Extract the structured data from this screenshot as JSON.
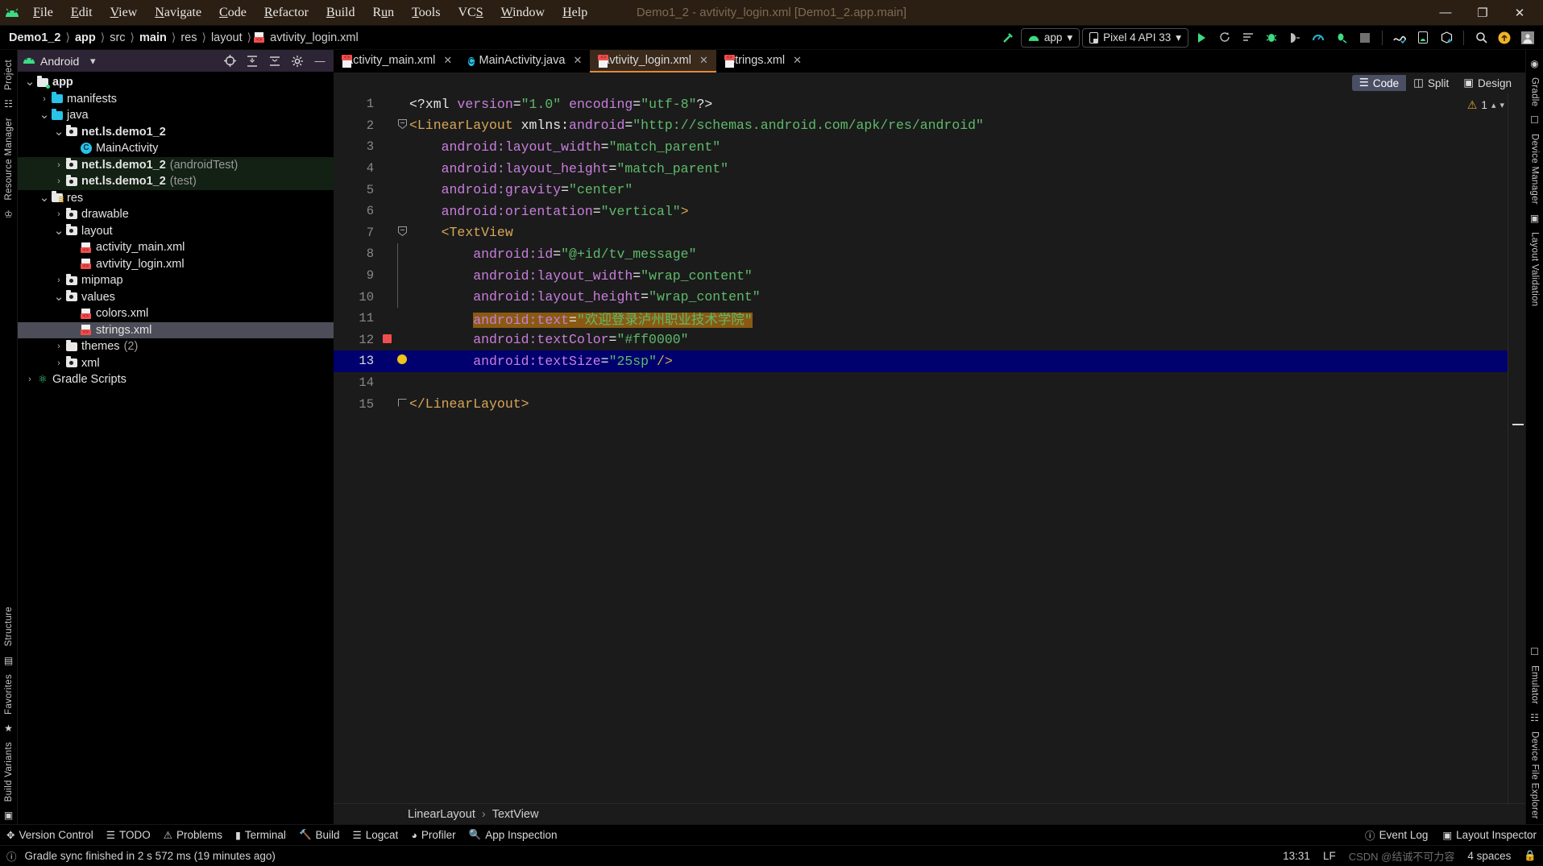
{
  "window": {
    "title": "Demo1_2 - avtivity_login.xml [Demo1_2.app.main]",
    "minimize": "—",
    "maximize": "❐",
    "close": "✕"
  },
  "menu": [
    "File",
    "Edit",
    "View",
    "Navigate",
    "Code",
    "Refactor",
    "Build",
    "Run",
    "Tools",
    "VCS",
    "Window",
    "Help"
  ],
  "breadcrumb": [
    {
      "label": "Demo1_2",
      "bold": true
    },
    {
      "label": "app",
      "bold": true
    },
    {
      "label": "src",
      "bold": false
    },
    {
      "label": "main",
      "bold": true
    },
    {
      "label": "res",
      "bold": false
    },
    {
      "label": "layout",
      "bold": false
    },
    {
      "label": "avtivity_login.xml",
      "bold": false
    }
  ],
  "toolbar": {
    "run_config": "app",
    "device": "Pixel 4 API 33",
    "icons": [
      "hammer-icon",
      "run-icon",
      "rerun-icon",
      "apply-changes-icon",
      "debug-icon",
      "attach-debugger-icon",
      "profiler-icon",
      "run-coverage-icon",
      "stop-icon",
      "sdk-manager-icon",
      "device-manager-icon",
      "avd-manager-icon",
      "search-icon",
      "update-icon",
      "account-icon",
      "settings-icon"
    ]
  },
  "project_panel": {
    "title": "Android",
    "header_icons": [
      "select-opened-file-icon",
      "collapse-all-icon",
      "expand-all-icon",
      "settings-gear-icon",
      "hide-icon"
    ],
    "tree": [
      {
        "label": "app",
        "sub": "",
        "depth": 0,
        "arrow": "down",
        "icon": "module-folder",
        "bold": true,
        "state": "normal"
      },
      {
        "label": "manifests",
        "sub": "",
        "depth": 1,
        "arrow": "right",
        "icon": "folder-blue",
        "bold": false,
        "state": "normal"
      },
      {
        "label": "java",
        "sub": "",
        "depth": 1,
        "arrow": "down",
        "icon": "folder-blue",
        "bold": false,
        "state": "normal"
      },
      {
        "label": "net.ls.demo1_2",
        "sub": "",
        "depth": 2,
        "arrow": "down",
        "icon": "package",
        "bold": true,
        "state": "normal"
      },
      {
        "label": "MainActivity",
        "sub": "",
        "depth": 3,
        "arrow": "none",
        "icon": "java-class",
        "bold": false,
        "state": "normal"
      },
      {
        "label": "net.ls.demo1_2",
        "sub": "(androidTest)",
        "depth": 2,
        "arrow": "right",
        "icon": "package",
        "bold": true,
        "state": "test"
      },
      {
        "label": "net.ls.demo1_2",
        "sub": "(test)",
        "depth": 2,
        "arrow": "right",
        "icon": "package",
        "bold": true,
        "state": "test"
      },
      {
        "label": "res",
        "sub": "",
        "depth": 1,
        "arrow": "down",
        "icon": "res-folder",
        "bold": false,
        "state": "normal"
      },
      {
        "label": "drawable",
        "sub": "",
        "depth": 2,
        "arrow": "right",
        "icon": "package",
        "bold": false,
        "state": "normal"
      },
      {
        "label": "layout",
        "sub": "",
        "depth": 2,
        "arrow": "down",
        "icon": "package",
        "bold": false,
        "state": "normal"
      },
      {
        "label": "activity_main.xml",
        "sub": "",
        "depth": 3,
        "arrow": "none",
        "icon": "xml-file",
        "bold": false,
        "state": "normal"
      },
      {
        "label": "avtivity_login.xml",
        "sub": "",
        "depth": 3,
        "arrow": "none",
        "icon": "xml-file",
        "bold": false,
        "state": "normal"
      },
      {
        "label": "mipmap",
        "sub": "",
        "depth": 2,
        "arrow": "right",
        "icon": "package",
        "bold": false,
        "state": "normal"
      },
      {
        "label": "values",
        "sub": "",
        "depth": 2,
        "arrow": "down",
        "icon": "package",
        "bold": false,
        "state": "normal"
      },
      {
        "label": "colors.xml",
        "sub": "",
        "depth": 3,
        "arrow": "none",
        "icon": "xml-file",
        "bold": false,
        "state": "normal"
      },
      {
        "label": "strings.xml",
        "sub": "",
        "depth": 3,
        "arrow": "none",
        "icon": "xml-file",
        "bold": false,
        "state": "selected"
      },
      {
        "label": "themes",
        "sub": "(2)",
        "depth": 2,
        "arrow": "right",
        "icon": "folder-white",
        "bold": false,
        "state": "normal"
      },
      {
        "label": "xml",
        "sub": "",
        "depth": 2,
        "arrow": "right",
        "icon": "package",
        "bold": false,
        "state": "normal"
      },
      {
        "label": "Gradle Scripts",
        "sub": "",
        "depth": 0,
        "arrow": "right",
        "icon": "gradle",
        "bold": false,
        "state": "normal"
      }
    ]
  },
  "left_rail": [
    "Project",
    "Resource Manager",
    "Structure",
    "Favorites",
    "Build Variants"
  ],
  "right_rail": [
    "Gradle",
    "Device Manager",
    "Layout Validation",
    "Emulator",
    "Device File Explorer"
  ],
  "editor": {
    "tabs": [
      {
        "label": "activity_main.xml",
        "icon": "xml-file-icon",
        "active": false,
        "close": "✕"
      },
      {
        "label": "MainActivity.java",
        "icon": "java-class-icon",
        "active": false,
        "close": "✕"
      },
      {
        "label": "avtivity_login.xml",
        "icon": "xml-file-icon",
        "active": true,
        "close": "✕"
      },
      {
        "label": "strings.xml",
        "icon": "xml-file-icon",
        "active": false,
        "close": "✕"
      }
    ],
    "view_modes": [
      {
        "label": "Code",
        "active": true,
        "icon": "code-view-icon"
      },
      {
        "label": "Split",
        "active": false,
        "icon": "split-view-icon"
      },
      {
        "label": "Design",
        "active": false,
        "icon": "design-view-icon"
      }
    ],
    "inspection": {
      "warning_count": "1",
      "warning_icon": "warning-triangle-icon"
    },
    "lines": [
      {
        "n": "1",
        "fold": "",
        "mark": "",
        "highlight": "none",
        "tokens": [
          {
            "t": "pun",
            "s": "<?xml "
          },
          {
            "t": "attr",
            "s": "version"
          },
          {
            "t": "pun",
            "s": "="
          },
          {
            "t": "val",
            "s": "\"1.0\""
          },
          {
            "t": "pun",
            "s": " "
          },
          {
            "t": "attr",
            "s": "encoding"
          },
          {
            "t": "pun",
            "s": "="
          },
          {
            "t": "val",
            "s": "\"utf-8\""
          },
          {
            "t": "pun",
            "s": "?>"
          }
        ]
      },
      {
        "n": "2",
        "fold": "minus",
        "mark": "",
        "highlight": "none",
        "tokens": [
          {
            "t": "tag",
            "s": "<LinearLayout "
          },
          {
            "t": "pun",
            "s": "xmlns:"
          },
          {
            "t": "attr",
            "s": "android"
          },
          {
            "t": "pun",
            "s": "="
          },
          {
            "t": "val",
            "s": "\"http://schemas.android.com/apk/res/android\""
          }
        ]
      },
      {
        "n": "3",
        "fold": "",
        "mark": "",
        "highlight": "none",
        "tokens": [
          {
            "t": "pun",
            "s": "    "
          },
          {
            "t": "attr",
            "s": "android:layout_width"
          },
          {
            "t": "pun",
            "s": "="
          },
          {
            "t": "val",
            "s": "\"match_parent\""
          }
        ]
      },
      {
        "n": "4",
        "fold": "",
        "mark": "",
        "highlight": "none",
        "tokens": [
          {
            "t": "pun",
            "s": "    "
          },
          {
            "t": "attr",
            "s": "android:layout_height"
          },
          {
            "t": "pun",
            "s": "="
          },
          {
            "t": "val",
            "s": "\"match_parent\""
          }
        ]
      },
      {
        "n": "5",
        "fold": "",
        "mark": "",
        "highlight": "none",
        "tokens": [
          {
            "t": "pun",
            "s": "    "
          },
          {
            "t": "attr",
            "s": "android:gravity"
          },
          {
            "t": "pun",
            "s": "="
          },
          {
            "t": "val",
            "s": "\"center\""
          }
        ]
      },
      {
        "n": "6",
        "fold": "",
        "mark": "",
        "highlight": "none",
        "tokens": [
          {
            "t": "pun",
            "s": "    "
          },
          {
            "t": "attr",
            "s": "android:orientation"
          },
          {
            "t": "pun",
            "s": "="
          },
          {
            "t": "val",
            "s": "\"vertical\""
          },
          {
            "t": "tag",
            "s": ">"
          }
        ]
      },
      {
        "n": "7",
        "fold": "minus",
        "mark": "",
        "highlight": "none",
        "tokens": [
          {
            "t": "pun",
            "s": "    "
          },
          {
            "t": "tag",
            "s": "<TextView"
          }
        ]
      },
      {
        "n": "8",
        "fold": "",
        "mark": "",
        "highlight": "none",
        "tokens": [
          {
            "t": "pun",
            "s": "        "
          },
          {
            "t": "attr",
            "s": "android:id"
          },
          {
            "t": "pun",
            "s": "="
          },
          {
            "t": "val",
            "s": "\"@+id/tv_message\""
          }
        ]
      },
      {
        "n": "9",
        "fold": "",
        "mark": "",
        "highlight": "none",
        "tokens": [
          {
            "t": "pun",
            "s": "        "
          },
          {
            "t": "attr",
            "s": "android:layout_width"
          },
          {
            "t": "pun",
            "s": "="
          },
          {
            "t": "val",
            "s": "\"wrap_content\""
          }
        ]
      },
      {
        "n": "10",
        "fold": "",
        "mark": "",
        "highlight": "none",
        "tokens": [
          {
            "t": "pun",
            "s": "        "
          },
          {
            "t": "attr",
            "s": "android:layout_height"
          },
          {
            "t": "pun",
            "s": "="
          },
          {
            "t": "val",
            "s": "\"wrap_content\""
          }
        ]
      },
      {
        "n": "11",
        "fold": "",
        "mark": "",
        "highlight": "orange",
        "tokens": [
          {
            "t": "pun",
            "s": "        "
          },
          {
            "t": "attr-hl",
            "s": "android:text"
          },
          {
            "t": "pun-hl",
            "s": "="
          },
          {
            "t": "val-hl",
            "s": "\"欢迎登录泸州职业技术学院\""
          }
        ]
      },
      {
        "n": "12",
        "fold": "",
        "mark": "breakpoint",
        "highlight": "none",
        "tokens": [
          {
            "t": "pun",
            "s": "        "
          },
          {
            "t": "attr",
            "s": "android:textColor"
          },
          {
            "t": "pun",
            "s": "="
          },
          {
            "t": "val",
            "s": "\"#ff0000\""
          }
        ]
      },
      {
        "n": "13",
        "fold": "bulb",
        "mark": "",
        "highlight": "cursor",
        "tokens": [
          {
            "t": "pun",
            "s": "        "
          },
          {
            "t": "attr",
            "s": "android:textSize"
          },
          {
            "t": "pun",
            "s": "="
          },
          {
            "t": "val",
            "s": "\"25sp\""
          },
          {
            "t": "tag",
            "s": "/>"
          }
        ]
      },
      {
        "n": "14",
        "fold": "",
        "mark": "",
        "highlight": "none",
        "tokens": []
      },
      {
        "n": "15",
        "fold": "end",
        "mark": "",
        "highlight": "none",
        "tokens": [
          {
            "t": "tag",
            "s": "</LinearLayout>"
          }
        ]
      }
    ],
    "breadcrumb_bottom": [
      "LinearLayout",
      "TextView"
    ],
    "breadcrumb_sep": "›"
  },
  "bottom_toolwindows": [
    {
      "label": "Version Control",
      "icon": "version-control-icon"
    },
    {
      "label": "TODO",
      "icon": "todo-icon"
    },
    {
      "label": "Problems",
      "icon": "problems-icon"
    },
    {
      "label": "Terminal",
      "icon": "terminal-icon"
    },
    {
      "label": "Build",
      "icon": "build-hammer-icon"
    },
    {
      "label": "Logcat",
      "icon": "logcat-icon"
    },
    {
      "label": "Profiler",
      "icon": "profiler-icon"
    },
    {
      "label": "App Inspection",
      "icon": "app-inspection-icon"
    }
  ],
  "bottom_toolwindows_right": [
    {
      "label": "Event Log",
      "icon": "event-log-icon"
    },
    {
      "label": "Layout Inspector",
      "icon": "layout-inspector-icon"
    }
  ],
  "statusbar": {
    "message": "Gradle sync finished in 2 s 572 ms (19 minutes ago)",
    "icon": "info-icon",
    "time": "13:31",
    "line_sep": "LF",
    "indent": "4 spaces",
    "watermark": "CSDN @结诚不可力容",
    "lock_icon": "lock-icon"
  },
  "colors": {
    "accent_orange": "#e08a3c",
    "android_green": "#3ddc84",
    "selection_blue": "#00006e",
    "highlight_orange": "#8a5a12",
    "error_red": "#ff0000"
  }
}
